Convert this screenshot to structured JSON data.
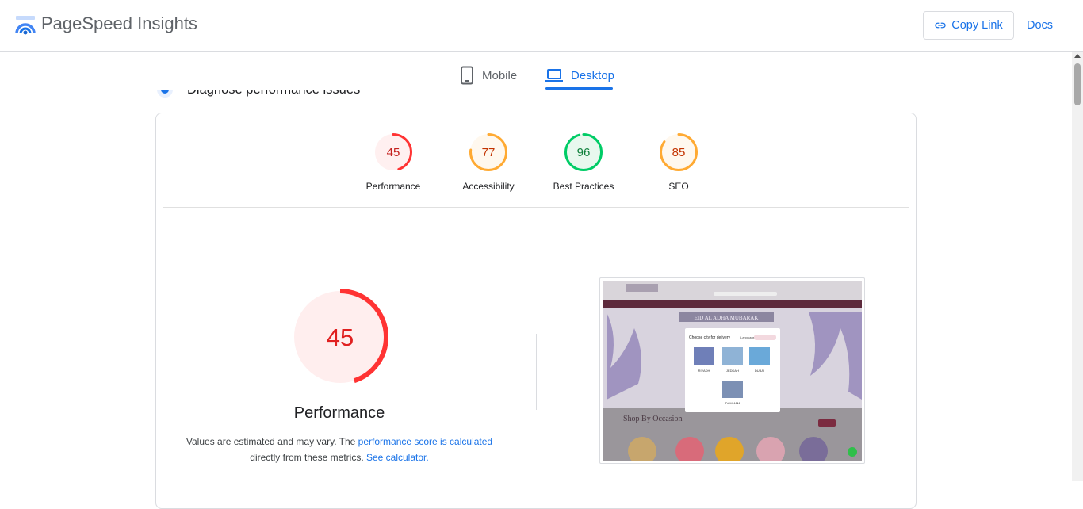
{
  "header": {
    "app_title": "PageSpeed Insights",
    "copy_link_label": "Copy Link",
    "docs_label": "Docs"
  },
  "tabs": [
    {
      "label": "Mobile",
      "active": false
    },
    {
      "label": "Desktop",
      "active": true
    }
  ],
  "section_title": "Diagnose performance issues",
  "scores": [
    {
      "label": "Performance",
      "value": 45,
      "color": "#ff3333",
      "bg": "#fff0f0"
    },
    {
      "label": "Accessibility",
      "value": 77,
      "color": "#ffaa33",
      "bg": "#fff8ee"
    },
    {
      "label": "Best Practices",
      "value": 96,
      "color": "#00cc66",
      "bg": "#e8f8ee"
    },
    {
      "label": "SEO",
      "value": 85,
      "color": "#ffaa33",
      "bg": "#fff8ee"
    }
  ],
  "performance": {
    "title": "Performance",
    "score": 45,
    "color": "#ff3333",
    "desc_prefix": "Values are estimated and may vary. The ",
    "desc_link1": "performance score is calculated",
    "desc_mid": " directly from these metrics. ",
    "desc_link2": "See calculator."
  },
  "screenshot": {
    "banner_text": "EID AL ADHA MUBARAK",
    "modal_title": "Choose city for delivery",
    "modal_lang_label": "Language",
    "cities": [
      "RIYADH",
      "JEDDAH",
      "DUBAI",
      "DAMMAM"
    ],
    "section_heading": "Shop By Occasion"
  }
}
